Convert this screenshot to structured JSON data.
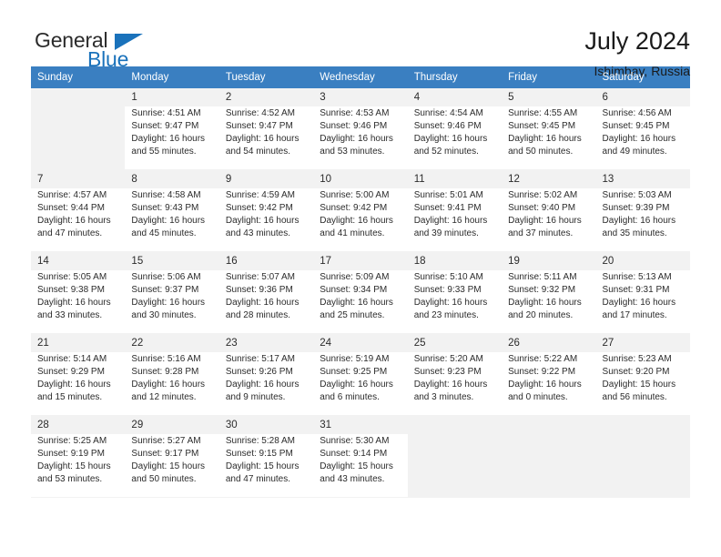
{
  "brand": {
    "name_top": "General",
    "name_bottom": "Blue",
    "accent_color": "#1a72bb"
  },
  "header": {
    "title": "July 2024",
    "subtitle": "Ishimbay, Russia"
  },
  "table": {
    "header_bg": "#3a7fc1",
    "columns": [
      "Sunday",
      "Monday",
      "Tuesday",
      "Wednesday",
      "Thursday",
      "Friday",
      "Saturday"
    ]
  },
  "weeks": [
    {
      "shaded": true,
      "days": [
        {
          "num": "",
          "sunrise": "",
          "sunset": "",
          "daylight1": "",
          "daylight2": "",
          "empty": true
        },
        {
          "num": "1",
          "sunrise": "Sunrise: 4:51 AM",
          "sunset": "Sunset: 9:47 PM",
          "daylight1": "Daylight: 16 hours",
          "daylight2": "and 55 minutes."
        },
        {
          "num": "2",
          "sunrise": "Sunrise: 4:52 AM",
          "sunset": "Sunset: 9:47 PM",
          "daylight1": "Daylight: 16 hours",
          "daylight2": "and 54 minutes."
        },
        {
          "num": "3",
          "sunrise": "Sunrise: 4:53 AM",
          "sunset": "Sunset: 9:46 PM",
          "daylight1": "Daylight: 16 hours",
          "daylight2": "and 53 minutes."
        },
        {
          "num": "4",
          "sunrise": "Sunrise: 4:54 AM",
          "sunset": "Sunset: 9:46 PM",
          "daylight1": "Daylight: 16 hours",
          "daylight2": "and 52 minutes."
        },
        {
          "num": "5",
          "sunrise": "Sunrise: 4:55 AM",
          "sunset": "Sunset: 9:45 PM",
          "daylight1": "Daylight: 16 hours",
          "daylight2": "and 50 minutes."
        },
        {
          "num": "6",
          "sunrise": "Sunrise: 4:56 AM",
          "sunset": "Sunset: 9:45 PM",
          "daylight1": "Daylight: 16 hours",
          "daylight2": "and 49 minutes."
        }
      ]
    },
    {
      "shaded": true,
      "days": [
        {
          "num": "7",
          "sunrise": "Sunrise: 4:57 AM",
          "sunset": "Sunset: 9:44 PM",
          "daylight1": "Daylight: 16 hours",
          "daylight2": "and 47 minutes."
        },
        {
          "num": "8",
          "sunrise": "Sunrise: 4:58 AM",
          "sunset": "Sunset: 9:43 PM",
          "daylight1": "Daylight: 16 hours",
          "daylight2": "and 45 minutes."
        },
        {
          "num": "9",
          "sunrise": "Sunrise: 4:59 AM",
          "sunset": "Sunset: 9:42 PM",
          "daylight1": "Daylight: 16 hours",
          "daylight2": "and 43 minutes."
        },
        {
          "num": "10",
          "sunrise": "Sunrise: 5:00 AM",
          "sunset": "Sunset: 9:42 PM",
          "daylight1": "Daylight: 16 hours",
          "daylight2": "and 41 minutes."
        },
        {
          "num": "11",
          "sunrise": "Sunrise: 5:01 AM",
          "sunset": "Sunset: 9:41 PM",
          "daylight1": "Daylight: 16 hours",
          "daylight2": "and 39 minutes."
        },
        {
          "num": "12",
          "sunrise": "Sunrise: 5:02 AM",
          "sunset": "Sunset: 9:40 PM",
          "daylight1": "Daylight: 16 hours",
          "daylight2": "and 37 minutes."
        },
        {
          "num": "13",
          "sunrise": "Sunrise: 5:03 AM",
          "sunset": "Sunset: 9:39 PM",
          "daylight1": "Daylight: 16 hours",
          "daylight2": "and 35 minutes."
        }
      ]
    },
    {
      "shaded": true,
      "days": [
        {
          "num": "14",
          "sunrise": "Sunrise: 5:05 AM",
          "sunset": "Sunset: 9:38 PM",
          "daylight1": "Daylight: 16 hours",
          "daylight2": "and 33 minutes."
        },
        {
          "num": "15",
          "sunrise": "Sunrise: 5:06 AM",
          "sunset": "Sunset: 9:37 PM",
          "daylight1": "Daylight: 16 hours",
          "daylight2": "and 30 minutes."
        },
        {
          "num": "16",
          "sunrise": "Sunrise: 5:07 AM",
          "sunset": "Sunset: 9:36 PM",
          "daylight1": "Daylight: 16 hours",
          "daylight2": "and 28 minutes."
        },
        {
          "num": "17",
          "sunrise": "Sunrise: 5:09 AM",
          "sunset": "Sunset: 9:34 PM",
          "daylight1": "Daylight: 16 hours",
          "daylight2": "and 25 minutes."
        },
        {
          "num": "18",
          "sunrise": "Sunrise: 5:10 AM",
          "sunset": "Sunset: 9:33 PM",
          "daylight1": "Daylight: 16 hours",
          "daylight2": "and 23 minutes."
        },
        {
          "num": "19",
          "sunrise": "Sunrise: 5:11 AM",
          "sunset": "Sunset: 9:32 PM",
          "daylight1": "Daylight: 16 hours",
          "daylight2": "and 20 minutes."
        },
        {
          "num": "20",
          "sunrise": "Sunrise: 5:13 AM",
          "sunset": "Sunset: 9:31 PM",
          "daylight1": "Daylight: 16 hours",
          "daylight2": "and 17 minutes."
        }
      ]
    },
    {
      "shaded": true,
      "days": [
        {
          "num": "21",
          "sunrise": "Sunrise: 5:14 AM",
          "sunset": "Sunset: 9:29 PM",
          "daylight1": "Daylight: 16 hours",
          "daylight2": "and 15 minutes."
        },
        {
          "num": "22",
          "sunrise": "Sunrise: 5:16 AM",
          "sunset": "Sunset: 9:28 PM",
          "daylight1": "Daylight: 16 hours",
          "daylight2": "and 12 minutes."
        },
        {
          "num": "23",
          "sunrise": "Sunrise: 5:17 AM",
          "sunset": "Sunset: 9:26 PM",
          "daylight1": "Daylight: 16 hours",
          "daylight2": "and 9 minutes."
        },
        {
          "num": "24",
          "sunrise": "Sunrise: 5:19 AM",
          "sunset": "Sunset: 9:25 PM",
          "daylight1": "Daylight: 16 hours",
          "daylight2": "and 6 minutes."
        },
        {
          "num": "25",
          "sunrise": "Sunrise: 5:20 AM",
          "sunset": "Sunset: 9:23 PM",
          "daylight1": "Daylight: 16 hours",
          "daylight2": "and 3 minutes."
        },
        {
          "num": "26",
          "sunrise": "Sunrise: 5:22 AM",
          "sunset": "Sunset: 9:22 PM",
          "daylight1": "Daylight: 16 hours",
          "daylight2": "and 0 minutes."
        },
        {
          "num": "27",
          "sunrise": "Sunrise: 5:23 AM",
          "sunset": "Sunset: 9:20 PM",
          "daylight1": "Daylight: 15 hours",
          "daylight2": "and 56 minutes."
        }
      ]
    },
    {
      "shaded": true,
      "days": [
        {
          "num": "28",
          "sunrise": "Sunrise: 5:25 AM",
          "sunset": "Sunset: 9:19 PM",
          "daylight1": "Daylight: 15 hours",
          "daylight2": "and 53 minutes."
        },
        {
          "num": "29",
          "sunrise": "Sunrise: 5:27 AM",
          "sunset": "Sunset: 9:17 PM",
          "daylight1": "Daylight: 15 hours",
          "daylight2": "and 50 minutes."
        },
        {
          "num": "30",
          "sunrise": "Sunrise: 5:28 AM",
          "sunset": "Sunset: 9:15 PM",
          "daylight1": "Daylight: 15 hours",
          "daylight2": "and 47 minutes."
        },
        {
          "num": "31",
          "sunrise": "Sunrise: 5:30 AM",
          "sunset": "Sunset: 9:14 PM",
          "daylight1": "Daylight: 15 hours",
          "daylight2": "and 43 minutes."
        },
        {
          "num": "",
          "sunrise": "",
          "sunset": "",
          "daylight1": "",
          "daylight2": "",
          "empty": true
        },
        {
          "num": "",
          "sunrise": "",
          "sunset": "",
          "daylight1": "",
          "daylight2": "",
          "empty": true
        },
        {
          "num": "",
          "sunrise": "",
          "sunset": "",
          "daylight1": "",
          "daylight2": "",
          "empty": true
        }
      ]
    }
  ]
}
